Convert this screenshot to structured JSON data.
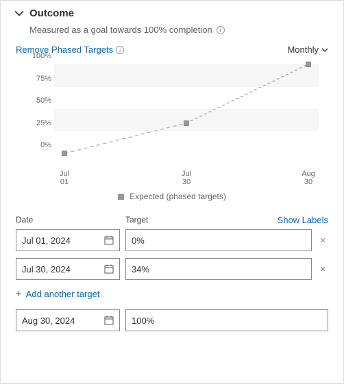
{
  "header": {
    "title": "Outcome",
    "subtitle": "Measured as a goal towards 100% completion"
  },
  "controls": {
    "remove_link": "Remove Phased Targets",
    "period_dropdown": "Monthly"
  },
  "chart_data": {
    "type": "line",
    "title": "",
    "xlabel": "",
    "ylabel": "",
    "ylim": [
      0,
      100
    ],
    "yticks": [
      "0%",
      "25%",
      "50%",
      "75%",
      "100%"
    ],
    "xticks": [
      "Jul\n01",
      "Jul\n30",
      "Aug\n30"
    ],
    "series": [
      {
        "name": "Expected (phased targets)",
        "x": [
          0,
          1,
          2
        ],
        "values": [
          0,
          34,
          100
        ]
      }
    ],
    "legend": "Expected (phased targets)"
  },
  "targets": {
    "columns": {
      "date": "Date",
      "target": "Target",
      "show_labels": "Show Labels"
    },
    "rows": [
      {
        "date": "Jul 01, 2024",
        "target": "0%"
      },
      {
        "date": "Jul 30, 2024",
        "target": "34%"
      }
    ],
    "add_label": "Add another target",
    "final": {
      "date": "Aug 30, 2024",
      "target": "100%"
    }
  }
}
